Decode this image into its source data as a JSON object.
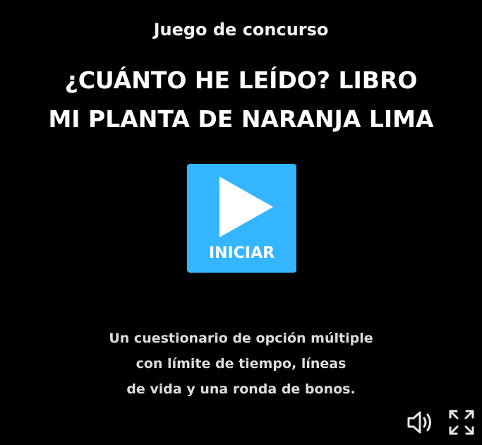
{
  "header": {
    "game_type": "Juego de concurso",
    "title_lines": [
      "¿CUÁNTO HE LEÍDO? LIBRO",
      "MI PLANTA DE NARANJA LIMA"
    ]
  },
  "start_button": {
    "label": "INICIAR",
    "icon": "play-icon",
    "color": "#33b6ff"
  },
  "description_lines": [
    "Un cuestionario de opción múltiple",
    "con límite de tiempo, líneas",
    "de vida y una ronda de bonos."
  ],
  "controls": {
    "sound_icon": "volume-icon",
    "fullscreen_icon": "fullscreen-icon"
  },
  "colors": {
    "background": "#000000",
    "accent": "#33b6ff",
    "text": "#ffffff"
  }
}
